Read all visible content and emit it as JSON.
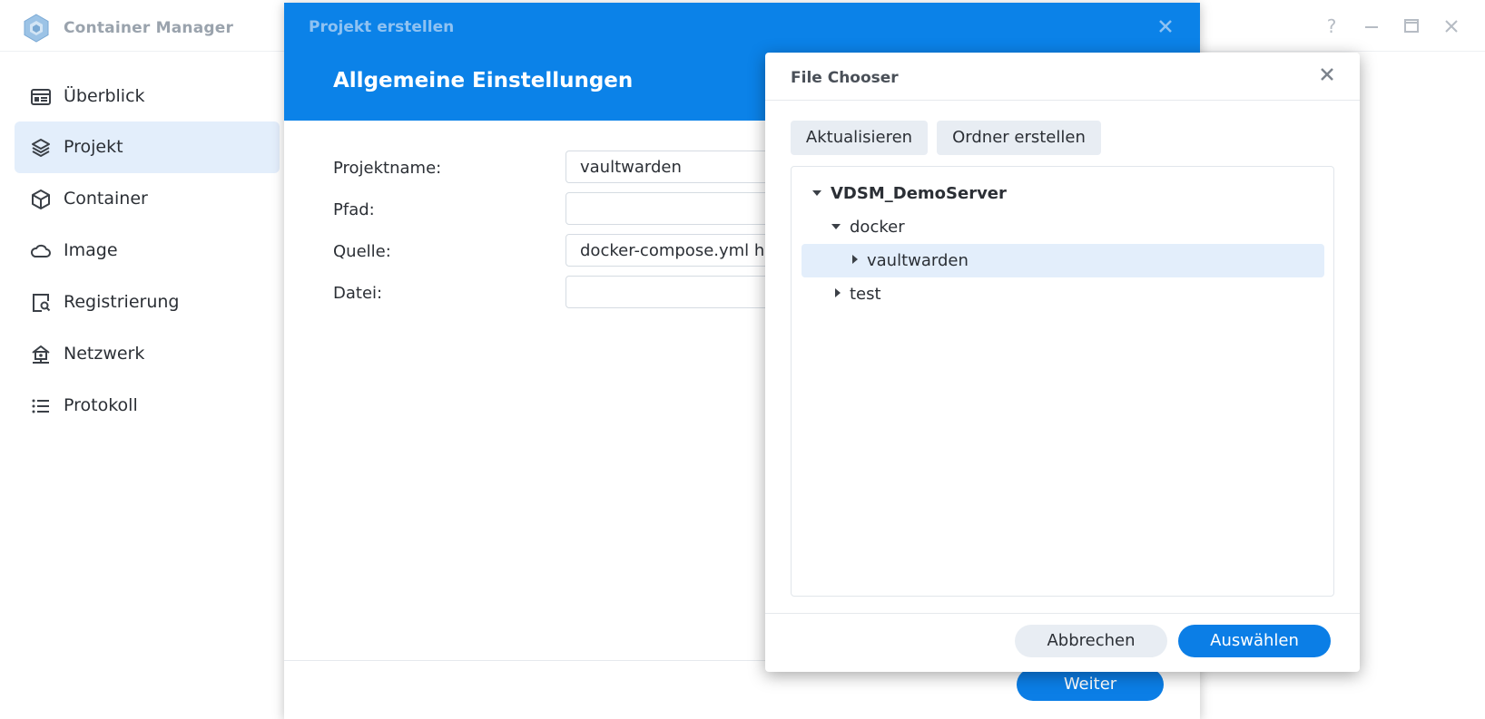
{
  "app": {
    "title": "Container Manager",
    "icons": [
      "app-logo-icon",
      "help-icon",
      "minimize-icon",
      "maximize-icon",
      "close-icon"
    ]
  },
  "sidebar": {
    "items": [
      {
        "label": "Überblick",
        "icon": "overview-icon",
        "active": false
      },
      {
        "label": "Projekt",
        "icon": "layers-icon",
        "active": true
      },
      {
        "label": "Container",
        "icon": "cube-icon",
        "active": false
      },
      {
        "label": "Image",
        "icon": "cloud-icon",
        "active": false
      },
      {
        "label": "Registrierung",
        "icon": "registry-search-icon",
        "active": false
      },
      {
        "label": "Netzwerk",
        "icon": "network-icon",
        "active": false
      },
      {
        "label": "Protokoll",
        "icon": "list-icon",
        "active": false
      }
    ]
  },
  "project_dialog": {
    "title": "Projekt erstellen",
    "subtitle": "Allgemeine Einstellungen",
    "fields": {
      "name_label": "Projektname:",
      "name_value": "vaultwarden",
      "path_label": "Pfad:",
      "path_value": "",
      "source_label": "Quelle:",
      "source_value": "docker-compose.yml h",
      "file_label": "Datei:",
      "file_value": ""
    },
    "next_button": "Weiter"
  },
  "file_chooser": {
    "title": "File Chooser",
    "refresh_button": "Aktualisieren",
    "create_folder_button": "Ordner erstellen",
    "tree": [
      {
        "label": "VDSM_DemoServer",
        "expanded": true,
        "bold": true,
        "selected": false
      },
      {
        "label": "docker",
        "expanded": true,
        "bold": false,
        "selected": false
      },
      {
        "label": "vaultwarden",
        "expanded": false,
        "bold": false,
        "selected": true
      },
      {
        "label": "test",
        "expanded": false,
        "bold": false,
        "selected": false
      }
    ],
    "cancel_button": "Abbrechen",
    "select_button": "Auswählen"
  },
  "colors": {
    "accent": "#0b82e8",
    "selection": "#e3eefb"
  }
}
